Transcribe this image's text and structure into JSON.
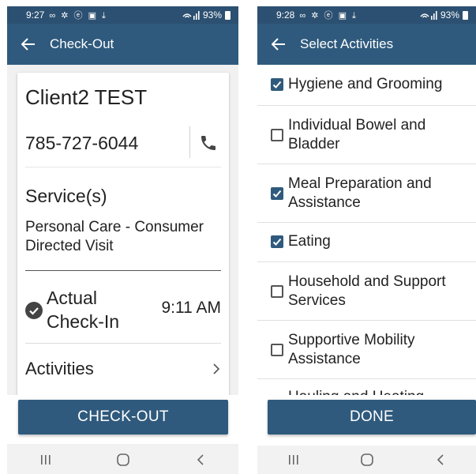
{
  "checkout_screen": {
    "status_bar": {
      "time": "9:27",
      "icons": "∞ ✲ ⓔ ▣ ⤓",
      "battery": "93%"
    },
    "title": "Check-Out",
    "client_name": "Client2 TEST",
    "phone_number": "785-727-6044",
    "services_label": "Service(s)",
    "service_name": "Personal Care - Consumer Directed Visit",
    "checkin_label": "Actual Check-In",
    "checkin_time": "9:11 AM",
    "activities_label": "Activities",
    "checkout_button": "CHECK-OUT"
  },
  "activities_screen": {
    "status_bar": {
      "time": "9:28",
      "icons": "∞ ✲ ⓔ ▣ ⤓",
      "battery": "93%"
    },
    "title": "Select Activities",
    "activities": [
      {
        "label": "Hygiene and Grooming",
        "checked": true
      },
      {
        "label": "Individual Bowel and Bladder",
        "checked": false
      },
      {
        "label": "Meal Preparation and Assistance",
        "checked": true
      },
      {
        "label": "Eating",
        "checked": true
      },
      {
        "label": "Household and Support Services",
        "checked": false
      },
      {
        "label": "Supportive Mobility Assistance",
        "checked": false
      }
    ],
    "partial_item": "Hauling and Heating",
    "done_button": "DONE"
  },
  "colors": {
    "primary": "#2f5a7d",
    "status_bar": "#2c5071"
  },
  "icons": [
    "back-arrow-icon",
    "phone-icon",
    "check-circle-icon",
    "chevron-right-icon",
    "checkbox-icon",
    "recent-apps-icon",
    "home-icon",
    "back-nav-icon"
  ]
}
